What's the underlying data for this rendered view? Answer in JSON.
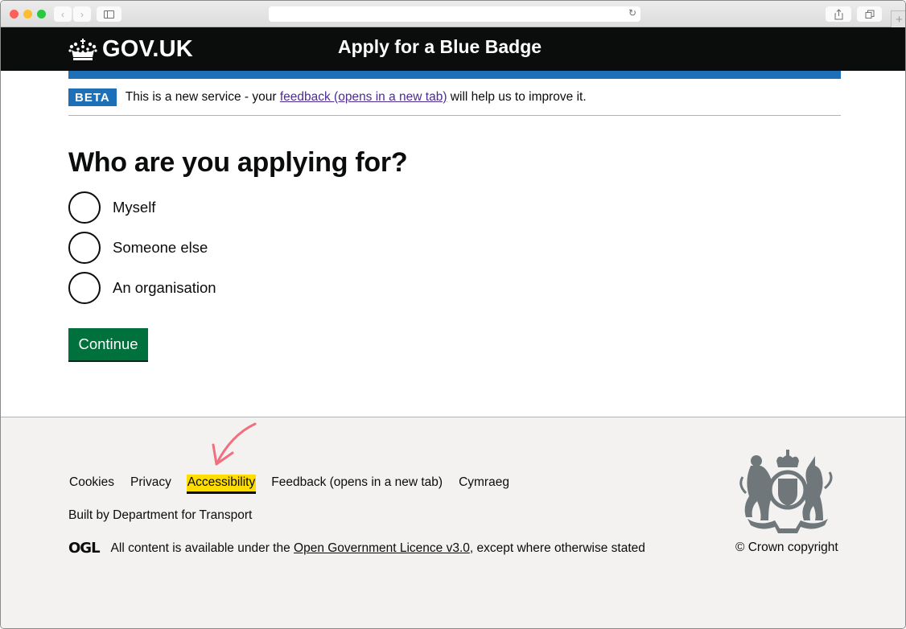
{
  "browser": {
    "address": "",
    "icons": {
      "back": "chevron-left-icon",
      "forward": "chevron-right-icon",
      "sidebar": "sidebar-icon",
      "reload": "reload-icon",
      "share": "share-icon",
      "tabs": "tabs-icon",
      "new_tab": "plus-icon"
    }
  },
  "header": {
    "logo_text": "GOV.UK",
    "service_name": "Apply for a Blue Badge"
  },
  "phase_banner": {
    "tag": "BETA",
    "text_before": "This is a new service - your ",
    "link_text": "feedback (opens in a new tab)",
    "text_after": " will help us to improve it."
  },
  "main": {
    "title": "Who are you applying for?",
    "options": [
      {
        "label": "Myself",
        "selected": false
      },
      {
        "label": "Someone else",
        "selected": false
      },
      {
        "label": "An organisation",
        "selected": false
      }
    ],
    "continue_label": "Continue"
  },
  "footer": {
    "links": [
      "Cookies",
      "Privacy",
      "Accessibility",
      "Feedback (opens in a new tab)",
      "Cymraeg"
    ],
    "focused_link": "Accessibility",
    "built_by": "Built by Department for Transport",
    "ogl_logo": "OGL",
    "licence_before": "All content is available under the ",
    "licence_link": "Open Government Licence v3.0",
    "licence_after": ", except where otherwise stated",
    "copyright": "© Crown copyright"
  },
  "colors": {
    "header_bg": "#0b0c0c",
    "brand_blue": "#1d70b8",
    "button_green": "#00703c",
    "focus_yellow": "#ffdd00",
    "visited_link": "#4c2c92",
    "footer_bg": "#f3f2f1",
    "annotation_arrow": "#f07080"
  }
}
